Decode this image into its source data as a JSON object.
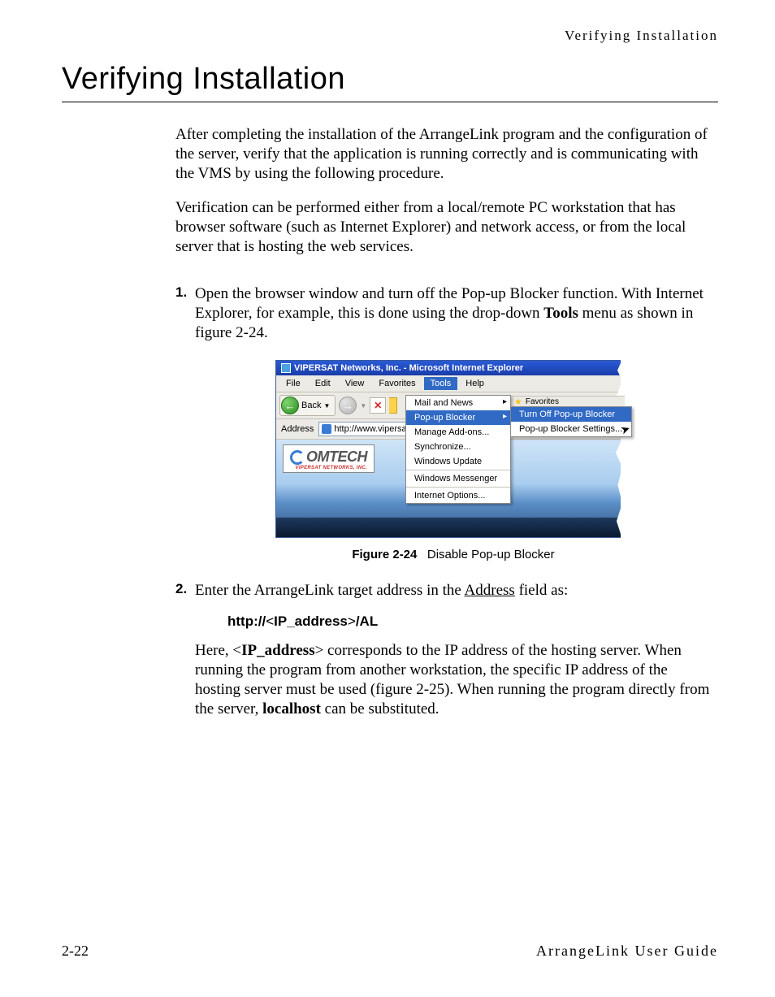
{
  "running_head": "Verifying Installation",
  "title": "Verifying Installation",
  "intro_p1": "After completing the installation of the ArrangeLink program and the configuration of the server, verify that the application is running correctly and is communicating with the VMS by using the following procedure.",
  "intro_p2": "Verification can be performed either from a local/remote PC workstation that has browser software (such as Internet Explorer) and network access, or from the local server that is hosting the web services.",
  "step1": {
    "num": "1.",
    "text_a": "Open the browser window and turn off the Pop-up Blocker function. With Internet Explorer, for example, this is done using the drop-down ",
    "tools": "Tools",
    "text_b": " menu as shown in figure 2-24."
  },
  "figure": {
    "label": "Figure 2-24",
    "caption": "Disable Pop-up Blocker",
    "window_title": "VIPERSAT Networks, Inc. - Microsoft Internet Explorer",
    "menu": {
      "file": "File",
      "edit": "Edit",
      "view": "View",
      "favorites": "Favorites",
      "tools": "Tools",
      "help": "Help"
    },
    "toolbar": {
      "back": "Back"
    },
    "addressbar": {
      "label": "Address",
      "value": "http://www.vipersa"
    },
    "fav_strip": "Favorites",
    "tools_items": {
      "mail": "Mail and News",
      "popup": "Pop-up Blocker",
      "addons": "Manage Add-ons...",
      "sync": "Synchronize...",
      "update": "Windows Update",
      "messenger": "Windows Messenger",
      "options": "Internet Options..."
    },
    "submenu": {
      "turn_off": "Turn Off Pop-up Blocker",
      "settings": "Pop-up Blocker Settings..."
    },
    "logo_main": "OMTECH",
    "logo_sub": "VIPERSAT NETWORKS, INC."
  },
  "step2": {
    "num": "2.",
    "text_a": "Enter the ArrangeLink target address in the ",
    "address_word": "Address",
    "text_b": " field as:",
    "code_pre": "http://",
    "code_ip": "IP_address",
    "code_post": "/AL",
    "para2_a": "Here, <",
    "para2_ip": "IP_address",
    "para2_b": "> corresponds to the IP address of the hosting server. When running the program from another workstation, the specific IP address of the hosting server must be used (figure 2-25). When running the program directly from the server, ",
    "localhost": "localhost",
    "para2_c": " can be substituted."
  },
  "footer": {
    "page": "2-22",
    "guide": "ArrangeLink User Guide"
  }
}
